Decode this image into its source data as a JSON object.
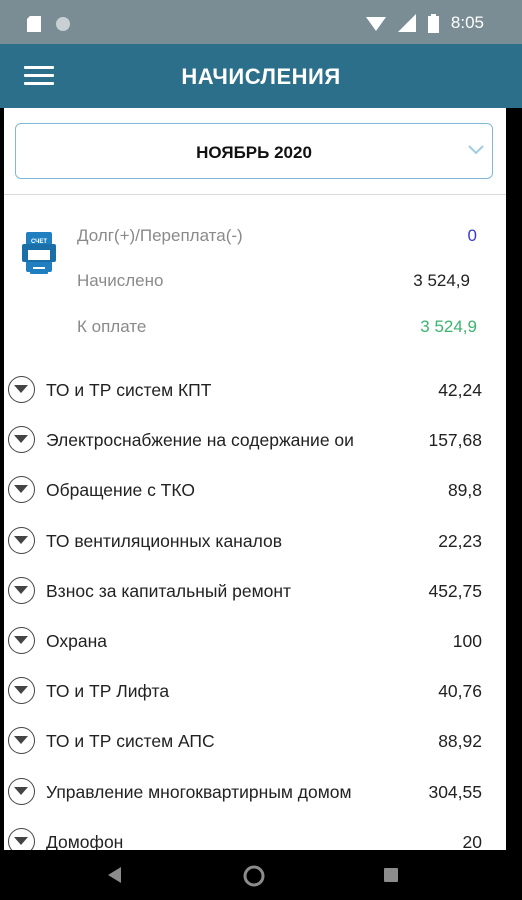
{
  "status_bar": {
    "time": "8:05"
  },
  "app_bar": {
    "title": "НАЧИСЛЕНИЯ"
  },
  "month_select": {
    "value": "НОЯБРЬ 2020"
  },
  "summary": {
    "debt_label": "Долг(+)/Переплата(-)",
    "debt_value": "0",
    "charged_label": "Начислено",
    "charged_value": "3 524,9",
    "topay_label": "К оплате",
    "topay_value": "3 524,9",
    "icon_text": "СЧЕТ",
    "colors": {
      "debt": "#3a3acf",
      "topay": "#3cb371",
      "label": "#8a8a8a"
    }
  },
  "items": [
    {
      "name": "ТО и ТР систем КПТ",
      "amount": "42,24"
    },
    {
      "name": "Электроснабжение на содержание ои",
      "amount": "157,68"
    },
    {
      "name": "Обращение с ТКО",
      "amount": "89,8"
    },
    {
      "name": "ТО вентиляционных каналов",
      "amount": "22,23"
    },
    {
      "name": "Взнос за капитальный ремонт",
      "amount": "452,75"
    },
    {
      "name": "Охрана",
      "amount": "100"
    },
    {
      "name": "ТО и ТР Лифта",
      "amount": "40,76"
    },
    {
      "name": "ТО и ТР систем АПС",
      "amount": "88,92"
    },
    {
      "name": "Управление многоквартирным домом",
      "amount": "304,55"
    },
    {
      "name": "Домофон",
      "amount": "20"
    }
  ],
  "theme": {
    "app_bar": "#2c6f8a",
    "status_bar": "#7a8c94",
    "select_border": "#7fb8d9"
  }
}
